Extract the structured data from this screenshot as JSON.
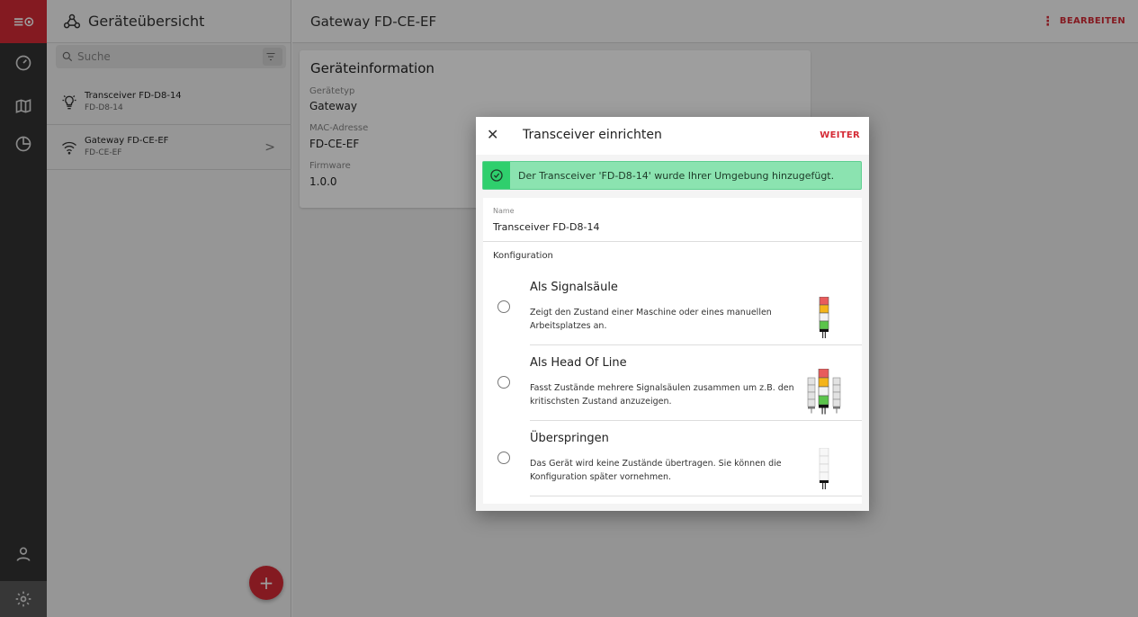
{
  "rail": {
    "logo": "≡⊙"
  },
  "sidebar": {
    "title": "Geräteübersicht",
    "search_placeholder": "Suche",
    "devices": [
      {
        "name": "Transceiver FD-D8-14",
        "id": "FD-D8-14",
        "icon": "lightbulb-icon"
      },
      {
        "name": "Gateway FD-CE-EF",
        "id": "FD-CE-EF",
        "icon": "wifi-icon"
      }
    ],
    "add_button": "+"
  },
  "main": {
    "title": "Gateway FD-CE-EF",
    "edit_label": "BEARBEITEN",
    "info": {
      "title": "Geräteinformation",
      "fields": [
        {
          "label": "Gerätetyp",
          "value": "Gateway"
        },
        {
          "label": "MAC-Adresse",
          "value": "FD-CE-EF"
        },
        {
          "label": "Firmware",
          "value": "1.0.0"
        }
      ]
    }
  },
  "dialog": {
    "close": "✕",
    "title": "Transceiver einrichten",
    "next_label": "WEITER",
    "success_message": "Der Transceiver 'FD-D8-14' wurde Ihrer Umgebung hinzugefügt.",
    "name_label": "Name",
    "name_value": "Transceiver FD-D8-14",
    "config_label": "Konfiguration",
    "options": [
      {
        "title": "Als Signalsäule",
        "description": "Zeigt den Zustand einer Maschine oder eines manuellen Arbeitsplatzes an.",
        "selected": false
      },
      {
        "title": "Als Head Of Line",
        "description": "Fasst Zustände mehrere Signalsäulen zusammen um z.B. den kritischsten Zustand anzuzeigen.",
        "selected": false
      },
      {
        "title": "Überspringen",
        "description": "Das Gerät wird keine Zustände übertragen. Sie können die Konfiguration später vornehmen.",
        "selected": false
      }
    ]
  },
  "colors": {
    "accent": "#d52b36",
    "success_bg": "#8be3b0",
    "success_icon_bg": "#2fcf6d"
  }
}
